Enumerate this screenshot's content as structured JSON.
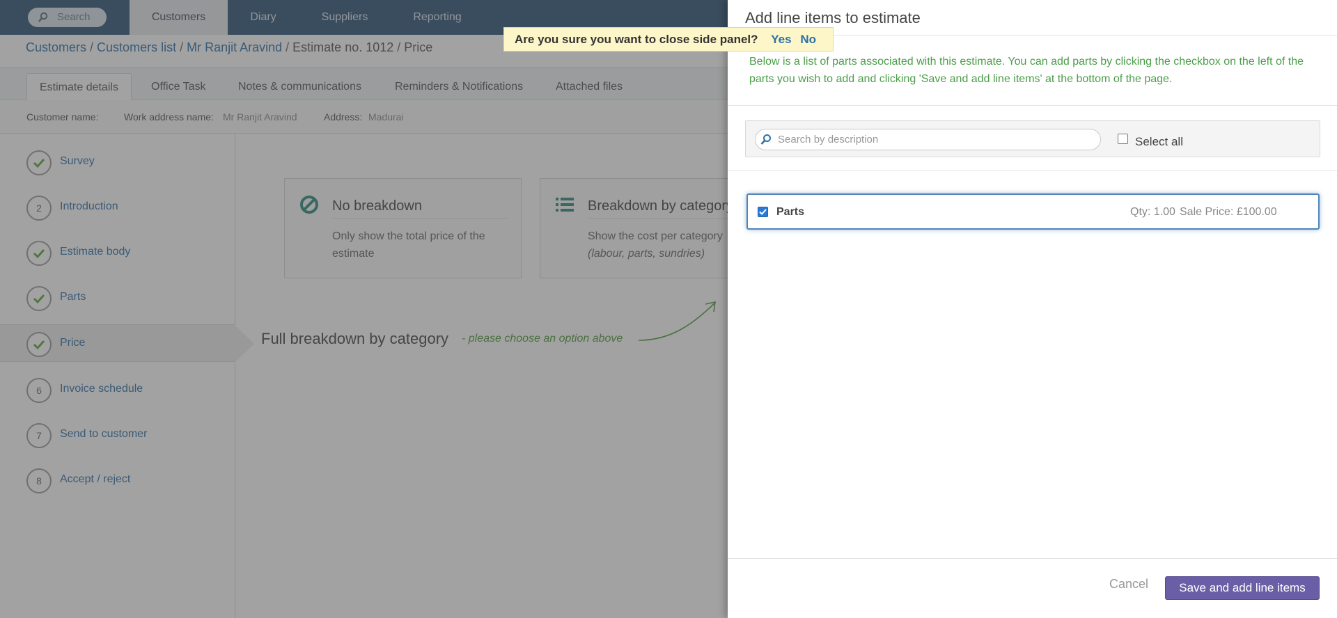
{
  "topnav": {
    "search_label": "Search",
    "tabs": [
      {
        "label": "Customers"
      },
      {
        "label": "Diary"
      },
      {
        "label": "Suppliers"
      },
      {
        "label": "Reporting"
      }
    ]
  },
  "breadcrumb": {
    "items": [
      "Customers",
      "Customers list",
      "Mr Ranjit Aravind",
      "Estimate no. 1012",
      "Price"
    ]
  },
  "tabs": [
    "Estimate details",
    "Office Task",
    "Notes & communications",
    "Reminders & Notifications",
    "Attached files"
  ],
  "info": {
    "customer_name_label": "Customer name:",
    "work_address_label": "Work address name:",
    "work_address_value": "Mr Ranjit Aravind",
    "address_label": "Address:",
    "address_value": "Madurai"
  },
  "steps": [
    {
      "label": "Survey",
      "status": "done"
    },
    {
      "label": "Introduction",
      "number": "2"
    },
    {
      "label": "Estimate body",
      "status": "done"
    },
    {
      "label": "Parts",
      "status": "done"
    },
    {
      "label": "Price",
      "status": "done"
    },
    {
      "label": "Invoice schedule",
      "number": "6"
    },
    {
      "label": "Send to customer",
      "number": "7"
    },
    {
      "label": "Accept / reject",
      "number": "8"
    }
  ],
  "cards": {
    "no_breakdown": {
      "title": "No breakdown",
      "desc1": "Only show the total price of the",
      "desc2": "estimate"
    },
    "by_category": {
      "title": "Breakdown by category",
      "desc1": "Show the cost per category",
      "desc2": "(labour, parts, sundries)"
    }
  },
  "main": {
    "heading": "Full breakdown by category",
    "hint": "- please choose an option above"
  },
  "confirm": {
    "question": "Are you sure you want to close side panel?",
    "yes": "Yes",
    "no": "No"
  },
  "panel": {
    "title": "Add line items to estimate",
    "description": "Below is a list of parts associated with this estimate. You can add parts by clicking the checkbox on the left of the parts you wish to add and clicking 'Save and add line items' at the bottom of the page.",
    "search_placeholder": "Search by description",
    "select_all_label": "Select all",
    "select_all_checked": false,
    "items": [
      {
        "name": "Parts",
        "qty": "Qty: 1.00",
        "price": "Sale Price: £100.00",
        "checked": true
      }
    ],
    "cancel_label": "Cancel",
    "save_label": "Save and add line items"
  },
  "colors": {
    "nav_bg": "#2d5577",
    "link": "#2e6fa6",
    "success_green": "#4b9e48",
    "primary_button": "#6a5fa7",
    "confirm_bg": "#fcf6c8"
  }
}
